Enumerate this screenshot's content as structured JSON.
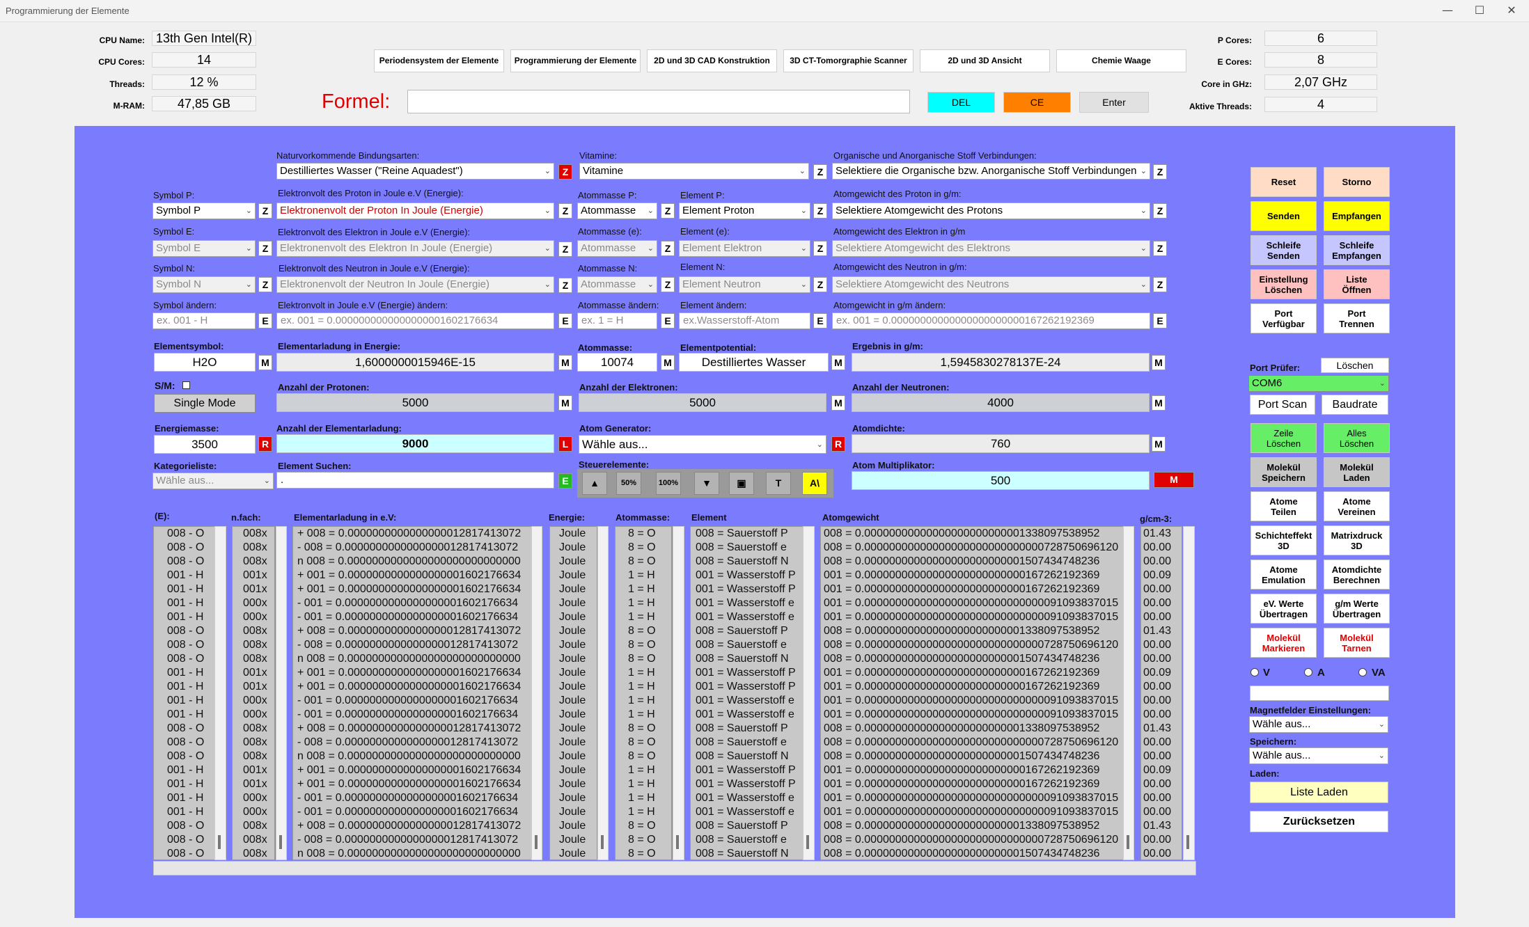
{
  "window": {
    "title": "Programmierung der Elemente",
    "min": "—",
    "max": "☐",
    "close": "✕"
  },
  "sysinfo": {
    "cpu_name_label": "CPU Name:",
    "cpu_name": "13th Gen Intel(R)",
    "cpu_cores_label": "CPU Cores:",
    "cpu_cores": "14",
    "threads_label": "Threads:",
    "threads": "12 %",
    "mram_label": "M-RAM:",
    "mram": "47,85 GB",
    "p_cores_label": "P Cores:",
    "p_cores": "6",
    "e_cores_label": "E Cores:",
    "e_cores": "8",
    "core_ghz_label": "Core in GHz:",
    "core_ghz": "2,07 GHz",
    "active_threads_label": "Aktive Threads:",
    "active_threads": "4"
  },
  "nav": [
    "Periodensystem der Elemente",
    "Programmierung der Elemente",
    "2D und 3D CAD Konstruktion",
    "3D CT-Tomorgraphie Scanner",
    "2D und 3D Ansicht",
    "Chemie Waage"
  ],
  "formula": {
    "label": "Formel:",
    "value": "",
    "del": "DEL",
    "ce": "CE",
    "enter": "Enter",
    "del_color": "#00ffff",
    "ce_color": "#ff8000"
  },
  "form": {
    "bindung_label": "Naturvorkommende Bindungsarten:",
    "bindung": "Destilliertes Wasser (\"Reine Aquadest\")",
    "vitamine_label": "Vitamine:",
    "vitamine": "Vitamine",
    "organik_label": "Organische und Anorganische Stoff Verbindungen:",
    "organik": "Selektiere die Organische bzw. Anorganische Stoff Verbindungen",
    "symbol_p_label": "Symbol P:",
    "symbol_p": "Symbol P",
    "ev_proton_label": "Elektronvolt des Proton in Joule e.V (Energie):",
    "ev_proton": "Elektronenvolt der Proton In Joule (Energie)",
    "am_p_label": "Atommasse P:",
    "am_p": "Atommasse",
    "el_p_label": "Element P:",
    "el_p": "Element Proton",
    "ag_p_label": "Atomgewicht des Proton in g/m:",
    "ag_p": "Selektiere Atomgewicht des Protons",
    "symbol_e_label": "Symbol E:",
    "symbol_e": "Symbol E",
    "ev_elektron_label": "Elektronvolt des Elektron in Joule e.V (Energie):",
    "ev_elektron": "Elektronenvolt des Elektron In Joule (Energie)",
    "am_e_label": "Atommasse (e):",
    "am_e": "Atommasse",
    "el_e_label": "Element (e):",
    "el_e": "Element Elektron",
    "ag_e_label": "Atomgewicht des Elektron in g/m",
    "ag_e": "Selektiere Atomgewicht des Elektrons",
    "symbol_n_label": "Symbol N:",
    "symbol_n": "Symbol N",
    "ev_neutron_label": "Elektronvolt des Neutron in Joule e.V (Energie):",
    "ev_neutron": "Elektronenvolt der Neutron In Joule (Energie)",
    "am_n_label": "Atommasse N:",
    "am_n": "Atommasse",
    "el_n_label": "Element N:",
    "el_n": "Element Neutron",
    "ag_n_label": "Atomgewicht des Neutron in g/m:",
    "ag_n": "Selektiere Atomgewicht des Neutrons",
    "sym_edit_label": "Symbol ändern:",
    "sym_edit_ph": "ex. 001 - H",
    "ev_edit_label": "Elektronvolt in Joule e.V (Energie) ändern:",
    "ev_edit_ph": "ex. 001 = 0.0000000000000000001602176634",
    "am_edit_label": "Atommasse ändern:",
    "am_edit_ph": "ex. 1  =  H",
    "el_edit_label": "Element ändern:",
    "el_edit_ph": "ex.Wasserstoff-Atom",
    "ag_edit_label": "Atomgewicht in g/m ändern:",
    "ag_edit_ph": "ex. 001 = 0.00000000000000000000000167262192369",
    "elsym_label": "Elementsymbol:",
    "elsym": "H2O",
    "elad_label": "Elementarladung in Energie:",
    "elad": "1,6000000015946E-15",
    "atommasse_label": "Atommasse:",
    "atommasse": "10074",
    "elpot_label": "Elementpotential:",
    "elpot": "Destilliertes Wasser",
    "erg_label": "Ergebnis in g/m:",
    "erg": "1,5945830278137E-24",
    "sm_label": "S/M:",
    "single_mode": "Single Mode",
    "protonen_label": "Anzahl der Protonen:",
    "protonen": "5000",
    "elektronen_label": "Anzahl der Elektronen:",
    "elektronen": "5000",
    "neutronen_label": "Anzahl der Neutronen:",
    "neutronen": "4000",
    "energiemasse_label": "Energiemasse:",
    "energiemasse": "3500",
    "anz_elad_label": "Anzahl der Elementarladung:",
    "anz_elad": "9000",
    "atomgen_label": "Atom Generator:",
    "atomgen": "Wähle aus...",
    "atomdichte_label": "Atomdichte:",
    "atomdichte": "760",
    "kat_label": "Kategorieliste:",
    "kat": "Wähle aus...",
    "suchen_label": "Element Suchen:",
    "suchen": ".",
    "steuer_label": "Steuerelemente:",
    "steuer": [
      "▲",
      "50%",
      "100%",
      "▼",
      "▣",
      "T",
      "A\\"
    ],
    "mult_label": "Atom Multiplikator:",
    "mult": "500",
    "z": "Z",
    "e": "E",
    "m": "M",
    "r": "R",
    "l": "L"
  },
  "list_headers": {
    "e": "(E):",
    "nfach": "n.fach:",
    "elad": "Elementarladung in e.V:",
    "energie": "Energie:",
    "atommasse": "Atommasse:",
    "element": "Element",
    "atomgewicht": "Atomgewicht",
    "gcm": "g/cm-3:"
  },
  "list": {
    "e": [
      "008 - O",
      "008 - O",
      "008 - O",
      "001 - H",
      "001 - H",
      "001 - H",
      "001 - H",
      "008 - O",
      "008 - O",
      "008 - O",
      "001 - H",
      "001 - H",
      "001 - H",
      "001 - H",
      "008 - O",
      "008 - O",
      "008 - O",
      "001 - H",
      "001 - H",
      "001 - H",
      "001 - H",
      "008 - O",
      "008 - O",
      "008 - O"
    ],
    "nfach": [
      "008x",
      "008x",
      "008x",
      "001x",
      "001x",
      "000x",
      "000x",
      "008x",
      "008x",
      "008x",
      "001x",
      "001x",
      "000x",
      "000x",
      "008x",
      "008x",
      "008x",
      "001x",
      "001x",
      "000x",
      "000x",
      "008x",
      "008x",
      "008x"
    ],
    "elad": [
      "+ 008 = 0.0000000000000000012817413072",
      "- 008 = 0.0000000000000000012817413072",
      "n 008 = 0.0000000000000000000000000000",
      "+ 001 = 0.0000000000000000001602176634",
      "+ 001 = 0.0000000000000000001602176634",
      "- 001 = 0.0000000000000000001602176634",
      "- 001 = 0.0000000000000000001602176634",
      "+ 008 = 0.0000000000000000012817413072",
      "- 008 = 0.0000000000000000012817413072",
      "n 008 = 0.0000000000000000000000000000",
      "+ 001 = 0.0000000000000000001602176634",
      "+ 001 = 0.0000000000000000001602176634",
      "- 001 = 0.0000000000000000001602176634",
      "- 001 = 0.0000000000000000001602176634",
      "+ 008 = 0.0000000000000000012817413072",
      "- 008 = 0.0000000000000000012817413072",
      "n 008 = 0.0000000000000000000000000000",
      "+ 001 = 0.0000000000000000001602176634",
      "+ 001 = 0.0000000000000000001602176634",
      "- 001 = 0.0000000000000000001602176634",
      "- 001 = 0.0000000000000000001602176634",
      "+ 008 = 0.0000000000000000012817413072",
      "- 008 = 0.0000000000000000012817413072",
      "n 008 = 0.0000000000000000000000000000"
    ],
    "energie": [
      "Joule",
      "Joule",
      "Joule",
      "Joule",
      "Joule",
      "Joule",
      "Joule",
      "Joule",
      "Joule",
      "Joule",
      "Joule",
      "Joule",
      "Joule",
      "Joule",
      "Joule",
      "Joule",
      "Joule",
      "Joule",
      "Joule",
      "Joule",
      "Joule",
      "Joule",
      "Joule",
      "Joule"
    ],
    "atommasse": [
      "8  =  O",
      "8  =  O",
      "8  =  O",
      "1  =  H",
      "1  =  H",
      "1  =  H",
      "1  =  H",
      "8  =  O",
      "8  =  O",
      "8  =  O",
      "1  =  H",
      "1  =  H",
      "1  =  H",
      "1  =  H",
      "8  =  O",
      "8  =  O",
      "8  =  O",
      "1  =  H",
      "1  =  H",
      "1  =  H",
      "1  =  H",
      "8  =  O",
      "8  =  O",
      "8  =  O"
    ],
    "element": [
      "008 = Sauerstoff P",
      "008 = Sauerstoff e",
      "008 = Sauerstoff N",
      "001 = Wasserstoff P",
      "001 = Wasserstoff P",
      "001 = Wasserstoff e",
      "001 = Wasserstoff e",
      "008 = Sauerstoff P",
      "008 = Sauerstoff e",
      "008 = Sauerstoff N",
      "001 = Wasserstoff P",
      "001 = Wasserstoff P",
      "001 = Wasserstoff e",
      "001 = Wasserstoff e",
      "008 = Sauerstoff P",
      "008 = Sauerstoff e",
      "008 = Sauerstoff N",
      "001 = Wasserstoff P",
      "001 = Wasserstoff P",
      "001 = Wasserstoff e",
      "001 = Wasserstoff e",
      "008 = Sauerstoff P",
      "008 = Sauerstoff e",
      "008 = Sauerstoff N"
    ],
    "atomgewicht": [
      "008 = 0.00000000000000000000000001338097538952",
      "008 = 0.00000000000000000000000000000728750696120",
      "008 = 0.00000000000000000000000001507434748236",
      "001 = 0.00000000000000000000000000167262192369",
      "001 = 0.00000000000000000000000000167262192369",
      "001 = 0.00000000000000000000000000000091093837015",
      "001 = 0.00000000000000000000000000000091093837015",
      "008 = 0.00000000000000000000000001338097538952",
      "008 = 0.00000000000000000000000000000728750696120",
      "008 = 0.00000000000000000000000001507434748236",
      "001 = 0.00000000000000000000000000167262192369",
      "001 = 0.00000000000000000000000000167262192369",
      "001 = 0.00000000000000000000000000000091093837015",
      "001 = 0.00000000000000000000000000000091093837015",
      "008 = 0.00000000000000000000000001338097538952",
      "008 = 0.00000000000000000000000000000728750696120",
      "008 = 0.00000000000000000000000001507434748236",
      "001 = 0.00000000000000000000000000167262192369",
      "001 = 0.00000000000000000000000000167262192369",
      "001 = 0.00000000000000000000000000000091093837015",
      "001 = 0.00000000000000000000000000000091093837015",
      "008 = 0.00000000000000000000000001338097538952",
      "008 = 0.00000000000000000000000000000728750696120",
      "008 = 0.00000000000000000000000001507434748236"
    ],
    "gcm": [
      "01.43",
      "00.00",
      "00.00",
      "00.09",
      "00.00",
      "00.00",
      "00.00",
      "01.43",
      "00.00",
      "00.00",
      "00.09",
      "00.00",
      "00.00",
      "00.00",
      "01.43",
      "00.00",
      "00.00",
      "00.09",
      "00.00",
      "00.00",
      "00.00",
      "01.43",
      "00.00",
      "00.00"
    ]
  },
  "right": {
    "reset": "Reset",
    "storno": "Storno",
    "senden": "Senden",
    "empfangen": "Empfangen",
    "schleife_senden": "Schleife\nSenden",
    "schleife_empfangen": "Schleife\nEmpfangen",
    "einst_loeschen": "Einstellung\nLöschen",
    "liste_oeffnen": "Liste\nÖffnen",
    "port_verf": "Port\nVerfügbar",
    "port_trennen": "Port\nTrennen",
    "port_pruefer_label": "Port Prüfer:",
    "loeschen": "Löschen",
    "com": "COM6",
    "port_scan": "Port Scan",
    "baudrate": "Baudrate",
    "zeile_loeschen": "Zeile\nLöschen",
    "alles_loeschen": "Alles\nLöschen",
    "mol_speichern": "Molekül\nSpeichern",
    "mol_laden": "Molekül\nLaden",
    "atome_teilen": "Atome\nTeilen",
    "atome_vereinen": "Atome\nVereinen",
    "schichteffekt": "Schichteffekt\n3D",
    "matrixdruck": "Matrixdruck\n3D",
    "atome_emulation": "Atome\nEmulation",
    "atomdichte_ber": "Atomdichte\nBerechnen",
    "ev_uebertragen": "eV. Werte\nÜbertragen",
    "gm_uebertragen": "g/m Werte\nÜbertragen",
    "mol_markieren": "Molekül\nMarkieren",
    "mol_tarnen": "Molekül\nTarnen",
    "radio_v": "V",
    "radio_a": "A",
    "radio_va": "VA",
    "magnet_label": "Magnetfelder Einstellungen:",
    "magnet": "Wähle aus...",
    "speichern_label": "Speichern:",
    "speichern": "Wähle aus...",
    "laden_label": "Laden:",
    "liste_laden": "Liste Laden",
    "zuruecksetzen": "Zurücksetzen"
  },
  "colors": {
    "panel": "#7b7bfe",
    "reset_bg": "#ffdcc6",
    "send_bg": "#ffff00",
    "loop_bg": "#c6c6ff",
    "clear_bg": "#ffc0c0",
    "green_bg": "#66ee66",
    "gray_bg": "#c6c6c6",
    "red_text": "#dd0000"
  }
}
